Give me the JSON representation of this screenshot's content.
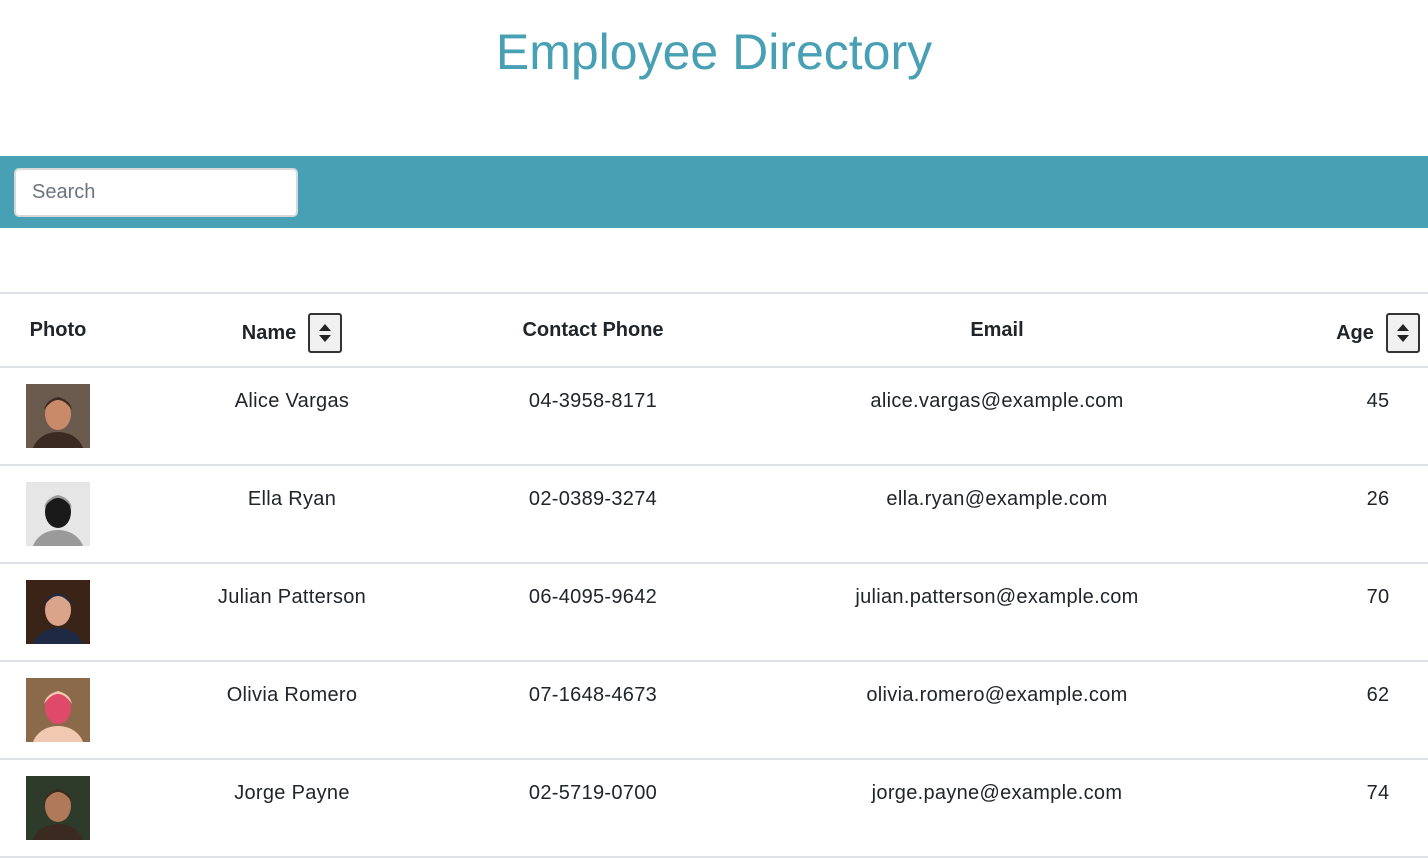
{
  "page": {
    "title": "Employee Directory"
  },
  "search": {
    "placeholder": "Search",
    "value": ""
  },
  "table": {
    "headers": {
      "photo": "Photo",
      "name": "Name",
      "phone": "Contact Phone",
      "email": "Email",
      "age": "Age"
    },
    "sort_icon": "sort-icon",
    "rows": [
      {
        "name": "Alice Vargas",
        "phone": "04-3958-8171",
        "email": "alice.vargas@example.com",
        "age": "45",
        "avatar_colors": [
          "#6b5a4e",
          "#c98a6a",
          "#3b2a22"
        ]
      },
      {
        "name": "Ella Ryan",
        "phone": "02-0389-3274",
        "email": "ella.ryan@example.com",
        "age": "26",
        "avatar_colors": [
          "#e6e6e6",
          "#1a1a1a",
          "#9a9a9a"
        ]
      },
      {
        "name": "Julian Patterson",
        "phone": "06-4095-9642",
        "email": "julian.patterson@example.com",
        "age": "70",
        "avatar_colors": [
          "#3a2418",
          "#d9a48a",
          "#1e2a44"
        ]
      },
      {
        "name": "Olivia Romero",
        "phone": "07-1648-4673",
        "email": "olivia.romero@example.com",
        "age": "62",
        "avatar_colors": [
          "#8a6a4a",
          "#e04a6a",
          "#f1c9b0"
        ]
      },
      {
        "name": "Jorge Payne",
        "phone": "02-5719-0700",
        "email": "jorge.payne@example.com",
        "age": "74",
        "avatar_colors": [
          "#2e3a2a",
          "#b07a5a",
          "#3a2a20"
        ]
      }
    ]
  },
  "colors": {
    "accent": "#48a0b5",
    "border": "#dee2e6"
  }
}
